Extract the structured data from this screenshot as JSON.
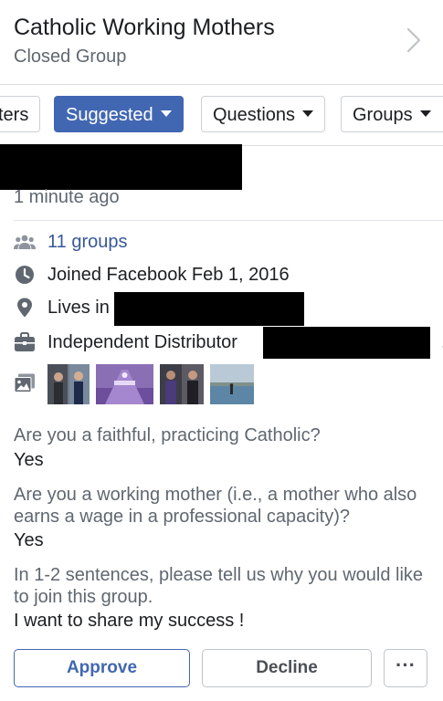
{
  "header": {
    "group_name": "Catholic Working Mothers",
    "group_type": "Closed Group",
    "chevron_icon": "chevron-right-icon"
  },
  "filters": {
    "partial_label": "ters",
    "suggested_label": "Suggested",
    "questions_label": "Questions",
    "groups_label": "Groups"
  },
  "member": {
    "time_ago": "1 minute ago",
    "groups": "11 groups",
    "joined": "Joined Facebook Feb 1, 2016",
    "lives_in": "Lives in",
    "work": "Independent Distributor",
    "work_trailing": "."
  },
  "questions": [
    {
      "q": "Are you a faithful, practicing Catholic?",
      "a": "Yes"
    },
    {
      "q": "Are you a working mother (i.e., a mother who also earns a wage in a professional capacity)?",
      "a": "Yes"
    },
    {
      "q": "In 1-2 sentences, please tell us why you would like to join this group.",
      "a": "I want to share my success !"
    }
  ],
  "actions": {
    "approve": "Approve",
    "decline": "Decline",
    "more": "···"
  },
  "colors": {
    "accent": "#4267b2",
    "link": "#385898",
    "secondary_text": "#606770",
    "redaction": "#000000"
  }
}
